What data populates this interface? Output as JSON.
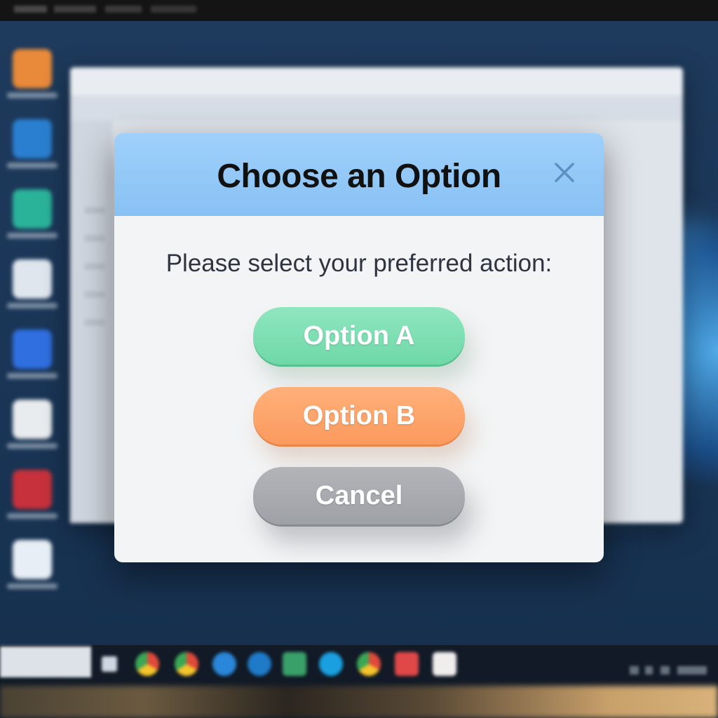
{
  "dialog": {
    "title": "Choose an Option",
    "prompt": "Please select your preferred action:",
    "buttons": {
      "option_a": "Option A",
      "option_b": "Option B",
      "cancel": "Cancel"
    },
    "close_icon": "close-icon"
  },
  "colors": {
    "header": "#9fd0fa",
    "option_a": "#7fdfb3",
    "option_b": "#fda46c",
    "cancel": "#a8aaaf",
    "dialog_bg": "#f3f4f5"
  },
  "taskbar": {
    "icons": [
      "chrome-icon",
      "chrome-icon",
      "app-icon",
      "edge-icon",
      "app-icon",
      "edge-icon",
      "chrome-icon",
      "app-icon",
      "app-icon"
    ]
  }
}
